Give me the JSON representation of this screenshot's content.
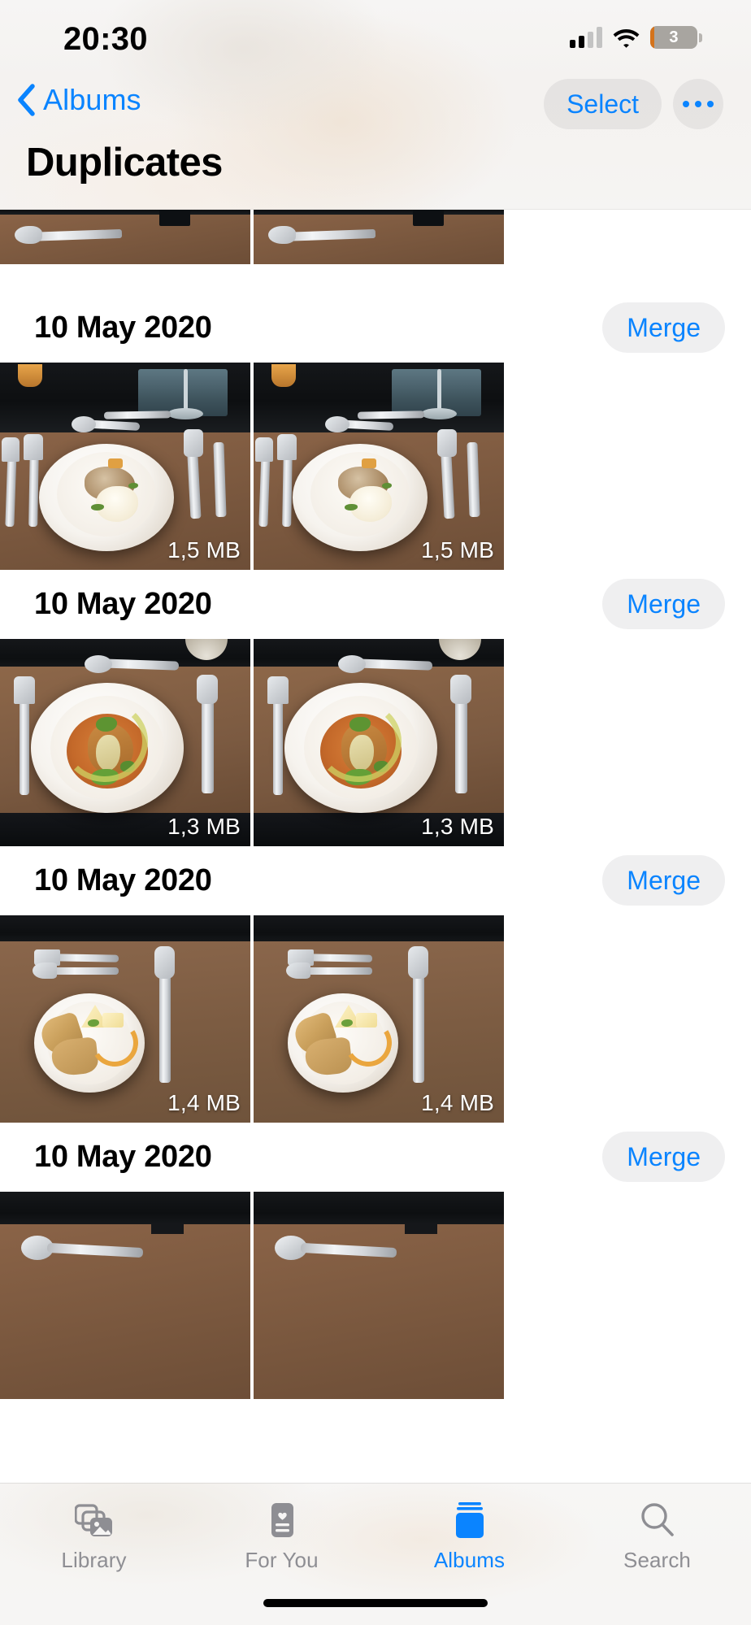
{
  "status_bar": {
    "time": "20:30",
    "battery_level": "3",
    "signal_icon": "cellular-bars-icon",
    "wifi_icon": "wifi-icon",
    "battery_icon": "battery-low-icon"
  },
  "nav": {
    "back_label": "Albums",
    "back_icon": "chevron-left-icon",
    "select_label": "Select",
    "more_icon": "ellipsis-icon"
  },
  "page_title": "Duplicates",
  "groups": [
    {
      "date": "10 May 2020",
      "merge_label": "Merge",
      "photos": [
        {
          "size": "1,5 MB"
        },
        {
          "size": "1,5 MB"
        }
      ]
    },
    {
      "date": "10 May 2020",
      "merge_label": "Merge",
      "photos": [
        {
          "size": "1,3 MB"
        },
        {
          "size": "1,3 MB"
        }
      ]
    },
    {
      "date": "10 May 2020",
      "merge_label": "Merge",
      "photos": [
        {
          "size": "1,4 MB"
        },
        {
          "size": "1,4 MB"
        }
      ]
    },
    {
      "date": "10 May 2020",
      "merge_label": "Merge",
      "photos": [
        {
          "size": ""
        },
        {
          "size": ""
        }
      ]
    }
  ],
  "tabbar": {
    "items": [
      {
        "label": "Library",
        "icon": "photo-stack-icon",
        "active": false
      },
      {
        "label": "For You",
        "icon": "heart-card-icon",
        "active": false
      },
      {
        "label": "Albums",
        "icon": "albums-book-icon",
        "active": true
      },
      {
        "label": "Search",
        "icon": "magnifier-icon",
        "active": false
      }
    ]
  },
  "colors": {
    "accent": "#0a84ff",
    "inactive": "#8e8e93",
    "pill_bg": "#e9e9eb",
    "battery_low": "#d4731c"
  }
}
